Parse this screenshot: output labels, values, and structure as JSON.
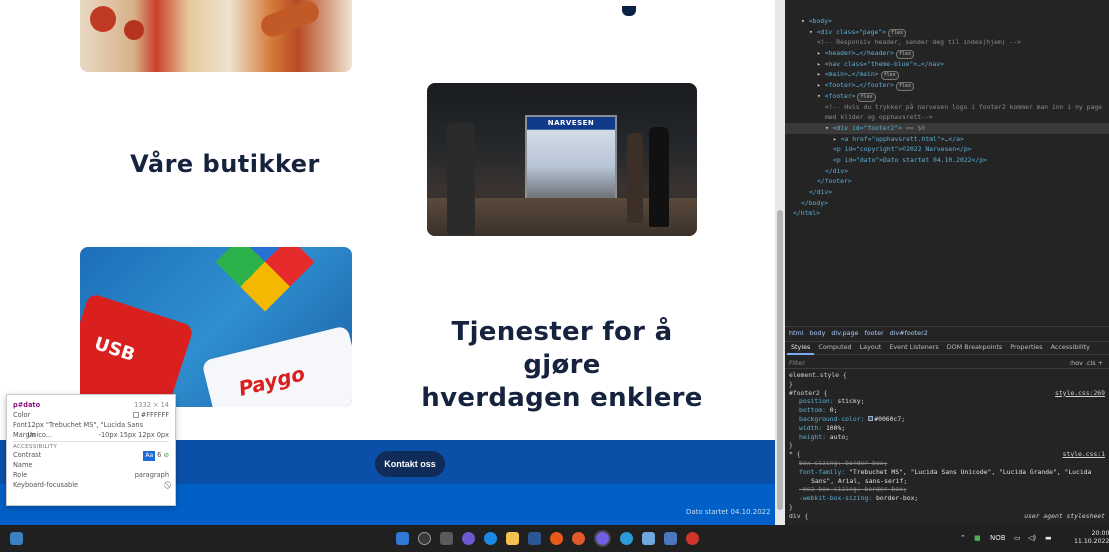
{
  "webpage": {
    "section_butikker": "Våre butikker",
    "section_tjenester_line1": "Tjenester for å gjøre",
    "section_tjenester_line2": "hverdagen enklere",
    "store_sign": "NARVESEN",
    "card_usb": "USB",
    "card_paygo": "Paygo",
    "contact_button": "Kontakt oss",
    "footer_date": "Dato startet 04.10.2022",
    "colors": {
      "footer": "#0060c7",
      "title": "#16233f",
      "button": "#0f2b58"
    }
  },
  "inspect_tooltip": {
    "selector": "p#dato",
    "size": "1332 × 14",
    "color_label": "Color",
    "color_value": "#FFFFFF",
    "font_label": "Font",
    "font_value": "12px \"Trebuchet MS\", \"Lucida Sans Unico...",
    "margin_label": "Margin",
    "margin_value": "-10px 15px 12px 0px",
    "accessibility_heading": "ACCESSIBILITY",
    "contrast_label": "Contrast",
    "contrast_badge": "Aa",
    "contrast_value": "6",
    "name_label": "Name",
    "name_value": "",
    "role_label": "Role",
    "role_value": "paragraph",
    "focusable_label": "Keyboard-focusable",
    "focusable_icon": "blocked-icon"
  },
  "devtools": {
    "dom": [
      {
        "tag": "<body>"
      },
      {
        "open": "<div class=\"page\">",
        "badge": "flex"
      },
      {
        "comment": "<!-- Responsiv header, sender deg til index(hjem) -->"
      },
      {
        "collapsed": "<header>…</header>",
        "badge": "flex"
      },
      {
        "collapsed": "<nav class=\"theme-blue\">…</nav>"
      },
      {
        "collapsed": "<main>…</main>",
        "badge": "flex"
      },
      {
        "collapsed": "<footer>…</footer>",
        "badge": "flex"
      },
      {
        "open": "<footer>",
        "badge": "flex"
      },
      {
        "comment": "<!-- Hvis du trykker på narvesen logo i footer2 kommer man inn i ny page"
      },
      {
        "comment": "med klider og opphavsrett-->"
      },
      {
        "open": "<div id=\"footer2\">",
        "suffix": " == $0"
      },
      {
        "collapsed": "<a href=\"opphavsrett.html\">…</a>"
      },
      {
        "text": "<p id=\"copyright\">©2022 Narvesen</p>"
      },
      {
        "text": "<p id=\"dato\">Dato startet 04.10.2022</p>"
      },
      {
        "close": "</div>"
      },
      {
        "close": "</footer>"
      },
      {
        "close": "</div>"
      },
      {
        "close": "</body>"
      },
      {
        "close": "</html>"
      }
    ],
    "breadcrumbs": [
      "html",
      "body",
      "div.page",
      "footer",
      "div#footer2"
    ],
    "tabs": [
      "Styles",
      "Computed",
      "Layout",
      "Event Listeners",
      "DOM Breakpoints",
      "Properties",
      "Accessibility"
    ],
    "active_tab": "Styles",
    "filter_placeholder": "Filter",
    "filter_buttons": ":hov  .cls  +",
    "styles": {
      "element_style": "element.style {",
      "rule1_selector": "#footer2 {",
      "rule1_source": "style.css:269",
      "rule1_props": [
        {
          "name": "position",
          "value": "sticky;"
        },
        {
          "name": "bottom",
          "value": "0;"
        },
        {
          "name": "background-color",
          "value": "#0060c7;",
          "swatch": "#0060c7"
        },
        {
          "name": "width",
          "value": "100%;"
        },
        {
          "name": "height",
          "value": "auto;"
        }
      ],
      "rule2_selector": "* {",
      "rule2_source": "style.css:1",
      "rule2_props": [
        {
          "name": "box-sizing",
          "value": "border-box;",
          "struck": true
        },
        {
          "name": "font-family",
          "value": "\"Trebuchet MS\", \"Lucida Sans Unicode\", \"Lucida Grande\", \"Lucida"
        },
        {
          "name": "",
          "value": "Sans\", Arial, sans-serif;"
        },
        {
          "name": "-moz-box-sizing",
          "value": "border-box;",
          "struck": true
        },
        {
          "name": "-webkit-box-sizing",
          "value": "border-box;"
        }
      ],
      "rule3_selector": "div {",
      "rule3_source": "user agent stylesheet"
    }
  },
  "taskbar": {
    "language": "NOB",
    "time": "20:00",
    "date": "11.10.2022"
  }
}
